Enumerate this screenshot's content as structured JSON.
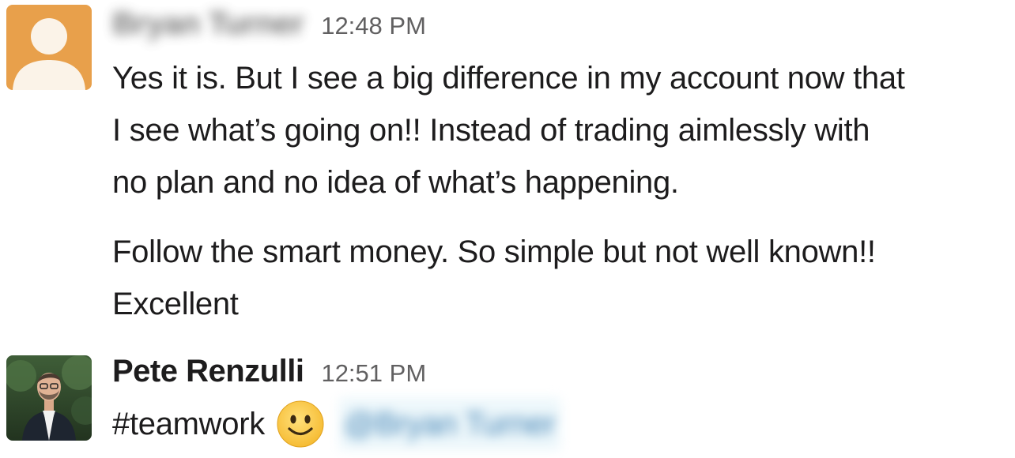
{
  "messages": [
    {
      "sender": "Bryan Turner",
      "sender_blurred": true,
      "avatar_icon": "default-user-avatar-icon",
      "avatar_color": "#E8A04B",
      "timestamp": "12:48 PM",
      "paragraphs": [
        {
          "lines": [
            "Yes it is. But I see a big difference in my account now that",
            "I see what’s going on!! Instead of trading aimlessly with",
            "no plan and no idea of what’s happening."
          ]
        },
        {
          "lines": [
            "Follow the smart money.  So simple but not well known!!",
            "Excellent"
          ]
        }
      ]
    },
    {
      "sender": "Pete Renzulli",
      "sender_blurred": false,
      "avatar_icon": "profile-photo-icon",
      "timestamp": "12:51 PM",
      "text": "#teamwork",
      "emoji": "slightly-smiling-face-icon",
      "mention": "@Bryan Turner",
      "mention_blurred": true
    }
  ]
}
